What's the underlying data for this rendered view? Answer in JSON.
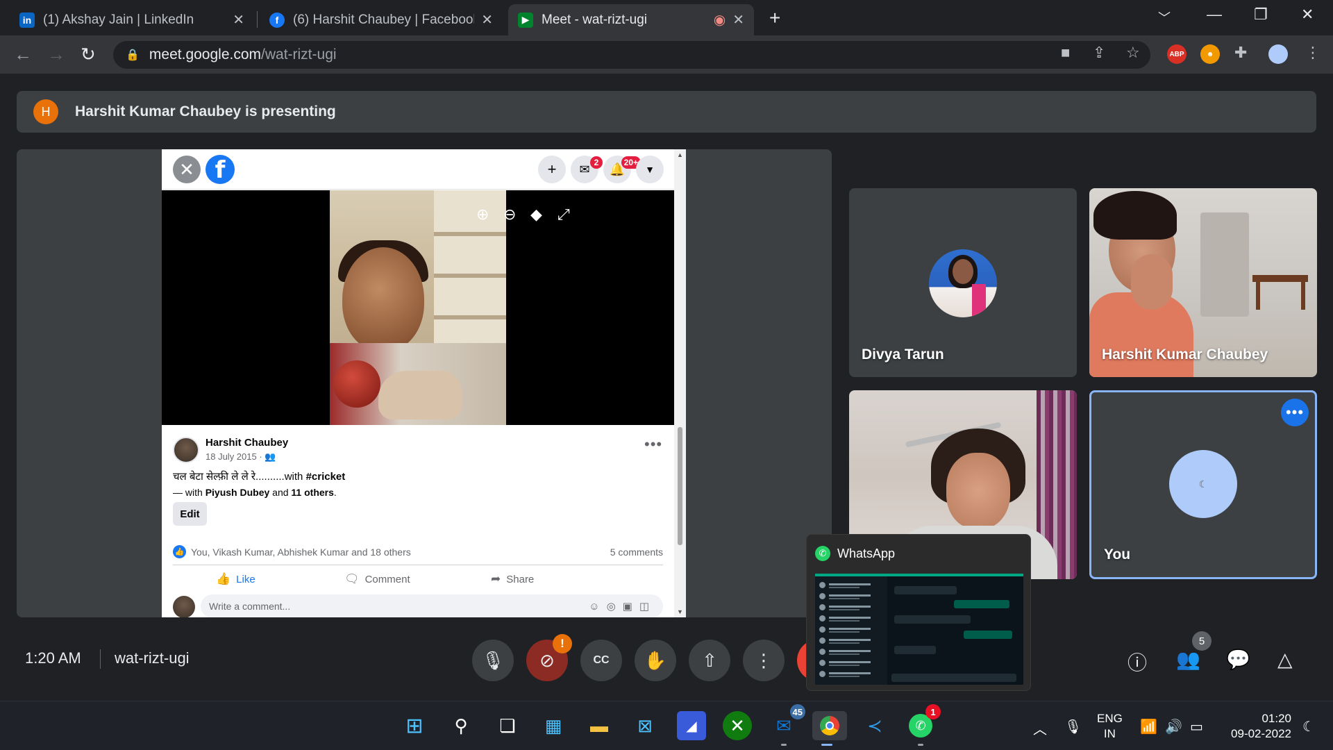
{
  "browser": {
    "tabs": [
      {
        "title": "(1) Akshay Jain | LinkedIn",
        "favicon": "linkedin-icon",
        "active": false
      },
      {
        "title": "(6) Harshit Chaubey | Facebook",
        "favicon": "facebook-icon",
        "active": false
      },
      {
        "title": "Meet - wat-rizt-ugi",
        "favicon": "google-meet-icon",
        "active": true,
        "recording": true
      }
    ],
    "address": {
      "host": "meet.google.com",
      "path": "/wat-rizt-ugi"
    },
    "extensions": [
      "camera-icon",
      "share-icon",
      "star-icon",
      "adblock-plus-icon",
      "tampermonkey-icon",
      "puzzle-extensions-icon",
      "profile-avatar",
      "kebab-menu-icon"
    ],
    "abp_label": "ABP"
  },
  "banner": {
    "avatar_letter": "H",
    "text": "Harshit Kumar Chaubey is presenting"
  },
  "shared_screen": {
    "notifications": {
      "messenger_count": "2",
      "notifications_count": "20+"
    },
    "post": {
      "author": "Harshit Chaubey",
      "date": "18 July 2015 · ",
      "text_before": "चल बेटा सेल्फ़ी ले ले रे..........with ",
      "hashtag": "#cricket",
      "with_prefix": "— with ",
      "with_person": "Piyush Dubey",
      "with_mid": " and ",
      "with_others": "11 others",
      "with_suffix": ".",
      "edit_label": "Edit",
      "reactions_text": "You, Vikash Kumar, Abhishek Kumar and 18 others",
      "comments_count": "5 comments",
      "actions": {
        "like": "Like",
        "comment": "Comment",
        "share": "Share"
      },
      "comment_placeholder": "Write a comment..."
    }
  },
  "participants": [
    {
      "name": "Divya Tarun"
    },
    {
      "name": "Harshit Kumar Chaubey"
    },
    {
      "name": ""
    },
    {
      "name": "You"
    }
  ],
  "whatsapp_preview": {
    "title": "WhatsApp"
  },
  "meet_bar": {
    "time": "1:20 AM",
    "code": "wat-rizt-ugi",
    "camera_warning": "!",
    "participants_count": "5"
  },
  "taskbar": {
    "apps": [
      "windows-start-icon",
      "search-icon",
      "task-view-icon",
      "widgets-icon",
      "file-explorer-icon",
      "microsoft-store-icon",
      "remote-desktop-icon",
      "xbox-icon",
      "outlook-icon",
      "chrome-icon",
      "vscode-icon",
      "whatsapp-icon"
    ],
    "outlook_badge": "45",
    "whatsapp_badge": "1",
    "lang_top": "ENG",
    "lang_bottom": "IN",
    "clock_time": "01:20",
    "clock_date": "09-02-2022"
  },
  "colors": {
    "meet_blue": "#8ab4f8",
    "facebook_blue": "#1877f2",
    "danger_red": "#ea4335",
    "presenter_orange": "#e8710a",
    "whatsapp_green": "#25d366"
  }
}
